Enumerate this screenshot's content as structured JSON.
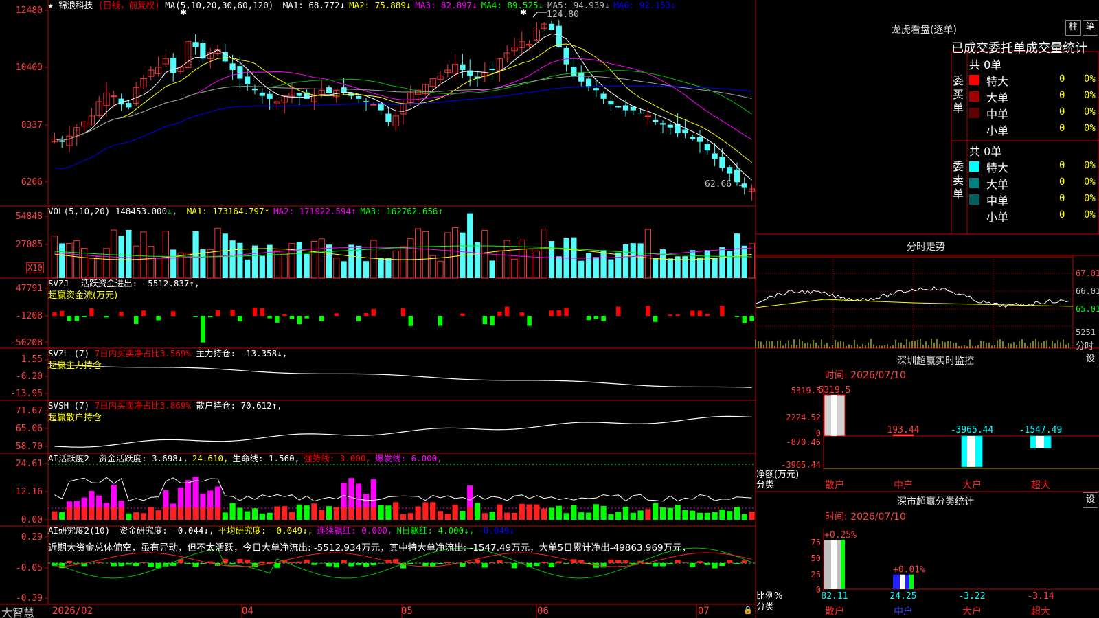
{
  "stock": {
    "name": "锦浪科技",
    "star_icon": "star-icon",
    "period": "(日线，前复权)"
  },
  "price_panel": {
    "ma_label": "MA(5,10,20,30,60,120)",
    "ma_values": [
      {
        "label": "MA1: 68.772",
        "arrow": "↓",
        "color": "#ffffff"
      },
      {
        "label": "MA2: 75.889",
        "arrow": "↓",
        "color": "#ffff00"
      },
      {
        "label": "MA3: 82.897",
        "arrow": "↓",
        "color": "#ff00ff"
      },
      {
        "label": "MA4: 89.525",
        "arrow": "↓",
        "color": "#00ff00"
      },
      {
        "label": "MA5: 94.939",
        "arrow": "↓",
        "color": "#c0c0c0"
      },
      {
        "label": "MA6: 92.153",
        "arrow": "↓",
        "color": "#0000ff"
      }
    ],
    "y_ticks": [
      "12480",
      "10409",
      "8337",
      "6266"
    ],
    "high_label": "124.80",
    "low_label": "62.66"
  },
  "vol_panel": {
    "title": "VOL(5,10,20)",
    "value": "148453.000",
    "items": [
      {
        "label": "MA1: 173164.797",
        "arrow": "↑",
        "color": "#ffff00"
      },
      {
        "label": "MA2: 171922.594",
        "arrow": "↑",
        "color": "#ff00ff"
      },
      {
        "label": "MA3: 162762.656",
        "arrow": "↑",
        "color": "#00ff00"
      }
    ],
    "y_ticks": [
      "54848",
      "27085"
    ],
    "unit": "X10"
  },
  "svzj_panel": {
    "title": "SVZJ",
    "line1": "活跃资金进出: -5512.837↑,",
    "line2": "超赢资金流(万元)",
    "y_ticks": [
      "47791",
      "-1208",
      "-50208"
    ]
  },
  "svzl_panel": {
    "title": "SVZL (7)",
    "part1": "7日内买卖净占比3.569%",
    "part2": "主力持仓: -13.358↓,",
    "line2": "超赢主力持仓",
    "y_ticks": [
      "1.55",
      "-6.20",
      "-13.95"
    ]
  },
  "svsh_panel": {
    "title": "SVSH (7)",
    "part1": "7日内买卖净占比3.869%",
    "part2": "散户持仓: 70.612↑,",
    "line2": "超赢散户持仓",
    "y_ticks": [
      "71.67",
      "65.06",
      "58.70"
    ]
  },
  "ai_active_panel": {
    "title": "AI活跃度2",
    "items": [
      {
        "label": "资金活跃度: 3.698↓,",
        "color": "#ffffff"
      },
      {
        "label": "24.610,",
        "color": "#ffff00"
      },
      {
        "label": "生命线: 1.560,",
        "color": "#ffffff"
      },
      {
        "label": "强势线: 3.000,",
        "color": "#ff0000"
      },
      {
        "label": "爆发线: 6.000,",
        "color": "#ff00ff"
      }
    ],
    "y_ticks": [
      "24.61",
      "12.16",
      "0.00"
    ]
  },
  "ai_research_panel": {
    "title": "AI研究度2(10)",
    "items": [
      {
        "label": "资金研究度: -0.044↓,",
        "color": "#ffffff"
      },
      {
        "label": "平均研究度: -0.049↓,",
        "color": "#ffff00"
      },
      {
        "label": "连续飘红: 0.000,",
        "color": "#ff00ff"
      },
      {
        "label": "N日飘红: 4.000↓,",
        "color": "#00ff00"
      },
      {
        "label": "-0.049↓",
        "color": "#0000ff"
      }
    ],
    "comment": "近期大资金总体偏空，虽有异动，但不太活跃，今日大单净流出: -5512.934万元，其中特大单净流出: -1547.49万元，大单5日累计净出-49863.969万元，",
    "y_ticks": [
      "0.29",
      "-0.05",
      "-0.39"
    ]
  },
  "x_axis": {
    "logo": "大智慧",
    "labels": [
      "2026/02",
      "04",
      "05",
      "06",
      "07"
    ]
  },
  "dragon_tiger": {
    "title": "龙虎看盘(逐单)",
    "btn_bar": "柱",
    "btn_pen": "笔",
    "tabs": "已成交委托单成交量统计",
    "buy": {
      "side_label": "委买单",
      "total": "共 0单",
      "rows": [
        {
          "name": "特大",
          "count": "0",
          "pct": "0%",
          "color": "#ff0000"
        },
        {
          "name": "大单",
          "count": "0",
          "pct": "0%",
          "color": "#a00000"
        },
        {
          "name": "中单",
          "count": "0",
          "pct": "0%",
          "color": "#600000"
        },
        {
          "name": "小单",
          "count": "0",
          "pct": "0%",
          "color": ""
        }
      ]
    },
    "sell": {
      "side_label": "委卖单",
      "total": "共 0单",
      "rows": [
        {
          "name": "特大",
          "count": "0",
          "pct": "0%",
          "color": "#00ffff"
        },
        {
          "name": "大单",
          "count": "0",
          "pct": "0%",
          "color": "#008080"
        },
        {
          "name": "中单",
          "count": "0",
          "pct": "0%",
          "color": "#006060"
        },
        {
          "name": "小单",
          "count": "0",
          "pct": "0%",
          "color": ""
        }
      ]
    }
  },
  "intraday": {
    "title": "分时走势",
    "y_ticks": [
      "67.01",
      "66.01",
      "65.01"
    ],
    "vol_tick": "5251",
    "unit": "分时"
  },
  "sz_monitor": {
    "title": "深圳超赢实时监控",
    "btn_settings": "设",
    "time": "时间: 2026/07/10",
    "y_ticks": [
      "5319.5",
      "2224.52",
      "0",
      "-870.46",
      "-3965.44"
    ],
    "unit": "净额(万元)",
    "cat_label": "分类",
    "bars": [
      {
        "name": "散户",
        "value": 5319.5,
        "label": "5319.5"
      },
      {
        "name": "中户",
        "value": 193.44,
        "label": "193.44"
      },
      {
        "name": "大户",
        "value": -3965.44,
        "label": "-3965.44"
      },
      {
        "name": "超大",
        "value": -1547.49,
        "label": "-1547.49"
      }
    ]
  },
  "sz_class": {
    "title": "深市超赢分类统计",
    "btn_settings": "设",
    "time": "时间: 2026/07/10",
    "y_ticks": [
      "75",
      "50",
      "25",
      "0"
    ],
    "unit": "比例%",
    "cat_label": "分类",
    "bars": [
      {
        "name": "散户",
        "value": 82.11,
        "label": "82.11",
        "change": "+0.25%"
      },
      {
        "name": "中户",
        "value": 24.25,
        "label": "24.25",
        "change": "+0.01%"
      },
      {
        "name": "大户",
        "value": -3.22,
        "label": "-3.22",
        "change": ""
      },
      {
        "name": "超大",
        "value": -3.14,
        "label": "-3.14",
        "change": ""
      }
    ]
  },
  "chart_data": {
    "type": "candlestick",
    "price_range": [
      62.66,
      124.8
    ],
    "candles_close_trend": [
      80,
      79,
      81,
      84,
      86,
      88,
      93,
      96,
      95,
      92,
      91,
      98,
      101,
      104,
      105,
      108,
      103,
      105,
      114,
      112,
      108,
      110,
      111,
      107,
      104,
      101,
      99,
      97,
      95,
      94,
      93,
      95,
      96,
      95,
      94,
      95,
      97,
      96,
      97,
      96,
      95,
      94,
      93,
      92,
      90,
      86,
      88,
      92,
      96,
      97,
      99,
      101,
      102,
      104,
      106,
      104,
      102,
      101,
      103,
      104,
      108,
      110,
      112,
      114,
      113,
      118,
      120,
      118,
      112,
      106,
      102,
      100,
      98,
      97,
      94,
      92,
      91,
      90,
      90,
      89,
      88,
      86,
      85,
      84,
      82,
      82,
      80,
      79,
      76,
      73,
      70,
      68,
      65,
      63,
      62.66
    ]
  }
}
